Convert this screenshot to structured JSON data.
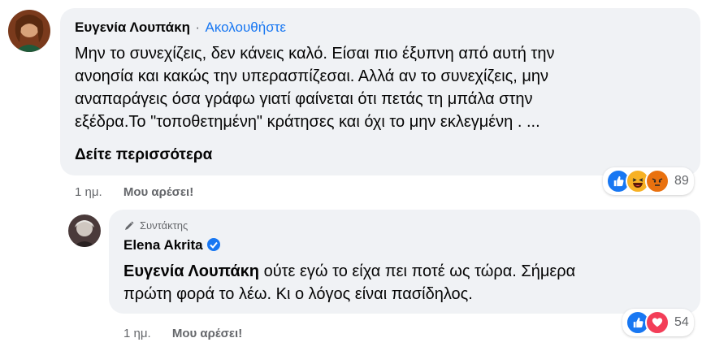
{
  "comment1": {
    "author": "Ευγενία Λουπάκη",
    "separator": "·",
    "follow_label": "Ακολουθήστε",
    "text_lines": [
      "Μην το συνεχίζεις, δεν κάνεις καλό. Είσαι πιο έξυπνη από αυτή την",
      "ανοησία και κακώς την υπερασπίζεσαι. Αλλά αν το συνεχίζεις, μην",
      "αναπαράγεις όσα γράφω γιατί φαίνεται ότι πετάς τη μπάλα στην",
      "εξέδρα.Το \"τοποθετημένη\" κράτησες και όχι το μην εκλεγμένη . ..."
    ],
    "see_more": "Δείτε περισσότερα",
    "time": "1 ημ.",
    "like_label": "Μου αρέσει!",
    "reaction_count": "89",
    "reaction_icons": [
      "like-icon",
      "haha-icon",
      "angry-icon"
    ]
  },
  "comment2": {
    "author_badge": "Συντάκτης",
    "author": "Elena Akrita",
    "mention": "Ευγενία Λουπάκη",
    "text_line1_rest": " ούτε εγώ το είχα πει ποτέ ως τώρα. Σήμερα",
    "text_line2": "πρώτη φορά το λέω. Κι ο λόγος είναι πασίδηλος.",
    "time": "1 ημ.",
    "like_label": "Μου αρέσει!",
    "reaction_count": "54",
    "reaction_icons": [
      "like-icon",
      "love-icon"
    ]
  },
  "colors": {
    "bubble": "#f0f2f5",
    "link_blue": "#1877f2",
    "muted": "#65676b",
    "like_blue": "#1877f2",
    "love_red": "#f33e58",
    "haha_yellow": "#f7b125",
    "angry_orange": "#e9710f"
  }
}
